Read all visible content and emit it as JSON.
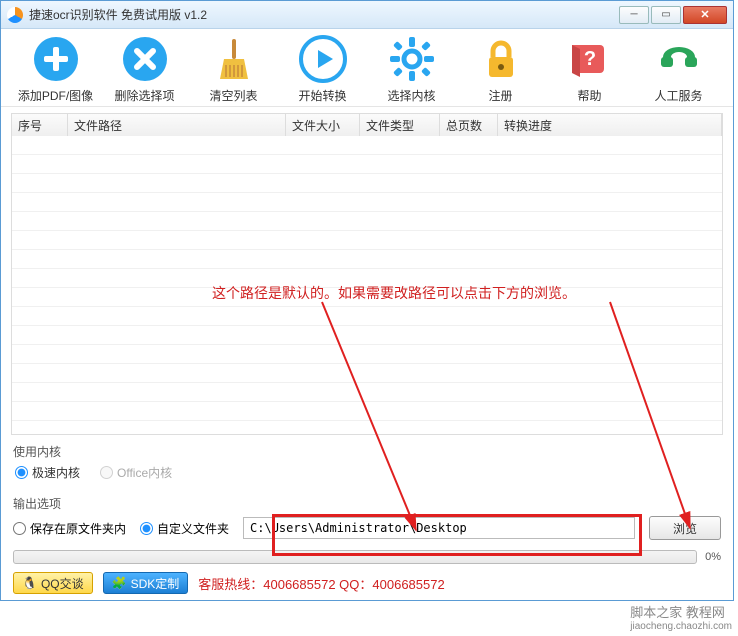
{
  "title": "捷速ocr识别软件 免费试用版 v1.2",
  "toolbar": [
    {
      "name": "add-pdf-image",
      "label": "添加PDF/图像"
    },
    {
      "name": "delete-selection",
      "label": "删除选择项"
    },
    {
      "name": "clear-list",
      "label": "清空列表"
    },
    {
      "name": "start-convert",
      "label": "开始转换"
    },
    {
      "name": "select-kernel",
      "label": "选择内核"
    },
    {
      "name": "register",
      "label": "注册"
    },
    {
      "name": "help",
      "label": "帮助"
    },
    {
      "name": "manual-service",
      "label": "人工服务"
    }
  ],
  "columns": {
    "idx": "序号",
    "path": "文件路径",
    "size": "文件大小",
    "type": "文件类型",
    "pages": "总页数",
    "progress": "转换进度"
  },
  "kernel": {
    "section": "使用内核",
    "fast": "极速内核",
    "office": "Office内核"
  },
  "output": {
    "section": "输出选项",
    "keep": "保存在原文件夹内",
    "custom": "自定义文件夹",
    "path": "C:\\Users\\Administrator\\Desktop",
    "browse": "浏览"
  },
  "progress_pct": "0%",
  "footer": {
    "qq": "QQ交谈",
    "sdk": "SDK定制",
    "hotline": "客服热线：4006685572 QQ：4006685572"
  },
  "annotation": "这个路径是默认的。如果需要改路径可以点击下方的浏览。",
  "watermark": "脚本之家 教程网",
  "watermark_sub": "jiaocheng.chaozhi.com"
}
